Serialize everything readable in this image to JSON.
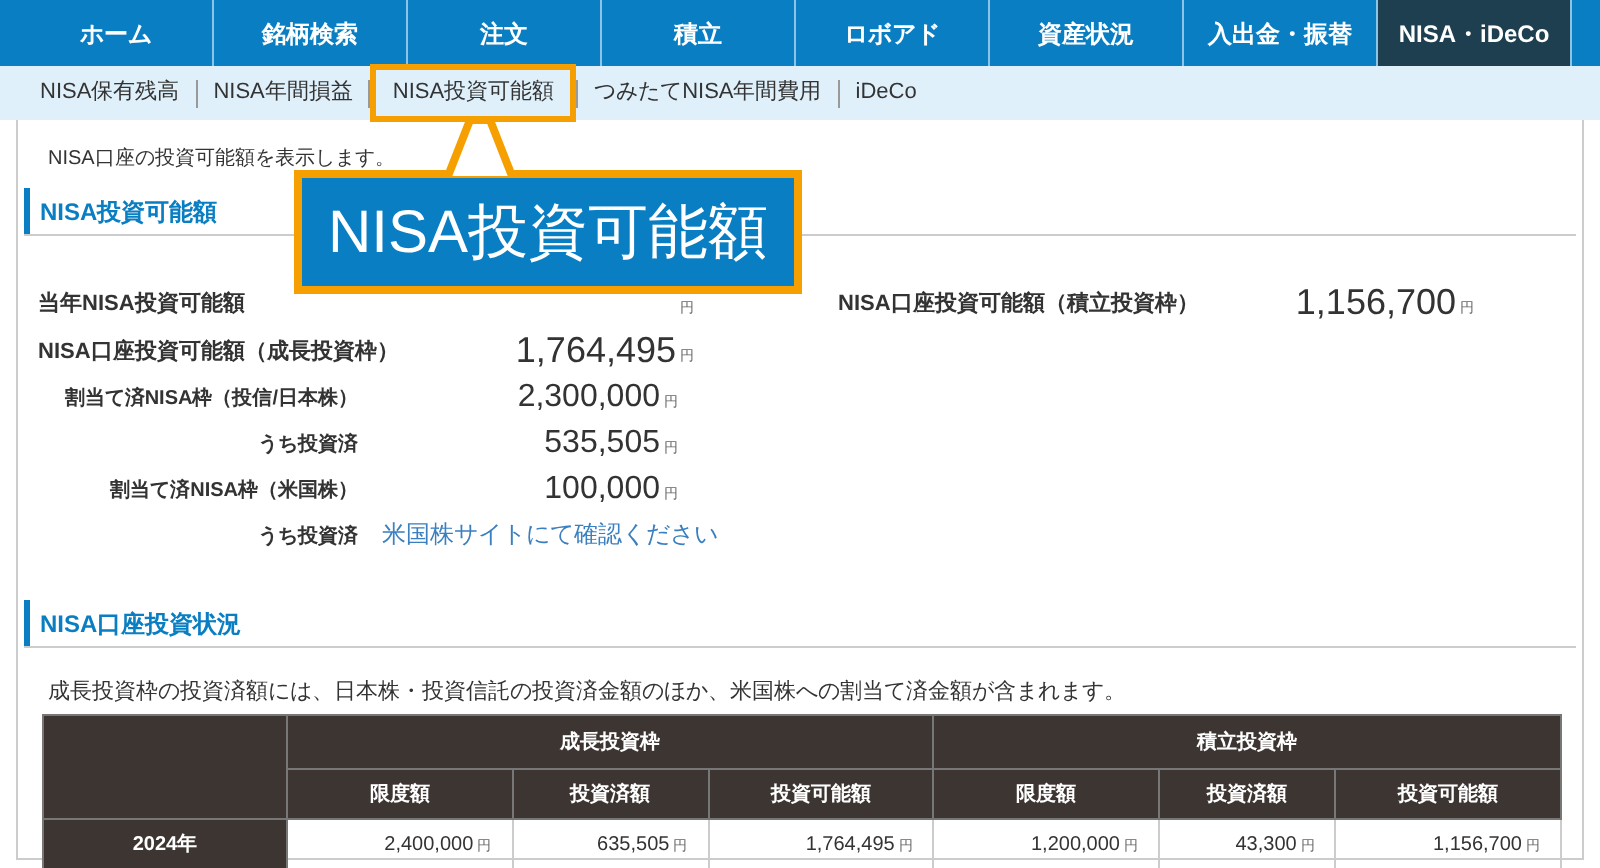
{
  "nav": {
    "tabs": [
      {
        "label": "ホーム",
        "selected": false
      },
      {
        "label": "銘柄検索",
        "selected": false
      },
      {
        "label": "注文",
        "selected": false
      },
      {
        "label": "積立",
        "selected": false
      },
      {
        "label": "ロボアド",
        "selected": false
      },
      {
        "label": "資産状況",
        "selected": false
      },
      {
        "label": "入出金・振替",
        "selected": false
      },
      {
        "label": "NISA・iDeCo",
        "selected": true
      }
    ]
  },
  "subnav": {
    "items": [
      {
        "label": "NISA保有残高",
        "highlighted": false
      },
      {
        "label": "NISA年間損益",
        "highlighted": false
      },
      {
        "label": "NISA投資可能額",
        "highlighted": true
      },
      {
        "label": "つみたてNISA年間費用",
        "highlighted": false
      },
      {
        "label": "iDeCo",
        "highlighted": false
      }
    ]
  },
  "callout": {
    "text": "NISA投資可能額"
  },
  "intro": "NISA口座の投資可能額を表示します。",
  "summary": {
    "title": "NISA投資可能額",
    "left_rows": [
      {
        "kind": "main",
        "label": "当年NISA投資可能額",
        "unit": "円"
      },
      {
        "kind": "main",
        "label": "NISA口座投資可能額（成長投資枠）",
        "value": "1,764,495",
        "unit": "円"
      },
      {
        "kind": "sub",
        "label": "割当て済NISA枠（投信/日本株）",
        "value": "2,300,000",
        "unit": "円"
      },
      {
        "kind": "sub",
        "label": "うち投資済",
        "value": "535,505",
        "unit": "円"
      },
      {
        "kind": "sub",
        "label": "割当て済NISA枠（米国株）",
        "value": "100,000",
        "unit": "円"
      },
      {
        "kind": "sub",
        "label": "うち投資済",
        "link": "米国株サイトにて確認ください"
      }
    ],
    "right_rows": [
      {
        "kind": "main",
        "label": "NISA口座投資可能額（積立投資枠）",
        "value": "1,156,700",
        "unit": "円"
      }
    ]
  },
  "status": {
    "title": "NISA口座投資状況",
    "note": "成長投資枠の投資済額には、日本株・投資信託の投資済金額のほか、米国株への割当て済金額が含まれます。",
    "table": {
      "groups": [
        "成長投資枠",
        "積立投資枠"
      ],
      "columns": [
        "限度額",
        "投資済額",
        "投資可能額",
        "限度額",
        "投資済額",
        "投資可能額"
      ],
      "rows": [
        {
          "label": "2024年",
          "cells": [
            {
              "value": "2,400,000",
              "unit": "円"
            },
            {
              "value": "635,505",
              "unit": "円"
            },
            {
              "value": "1,764,495",
              "unit": "円"
            },
            {
              "value": "1,200,000",
              "unit": "円"
            },
            {
              "value": "43,300",
              "unit": "円"
            },
            {
              "value": "1,156,700",
              "unit": "円"
            }
          ]
        }
      ]
    }
  }
}
